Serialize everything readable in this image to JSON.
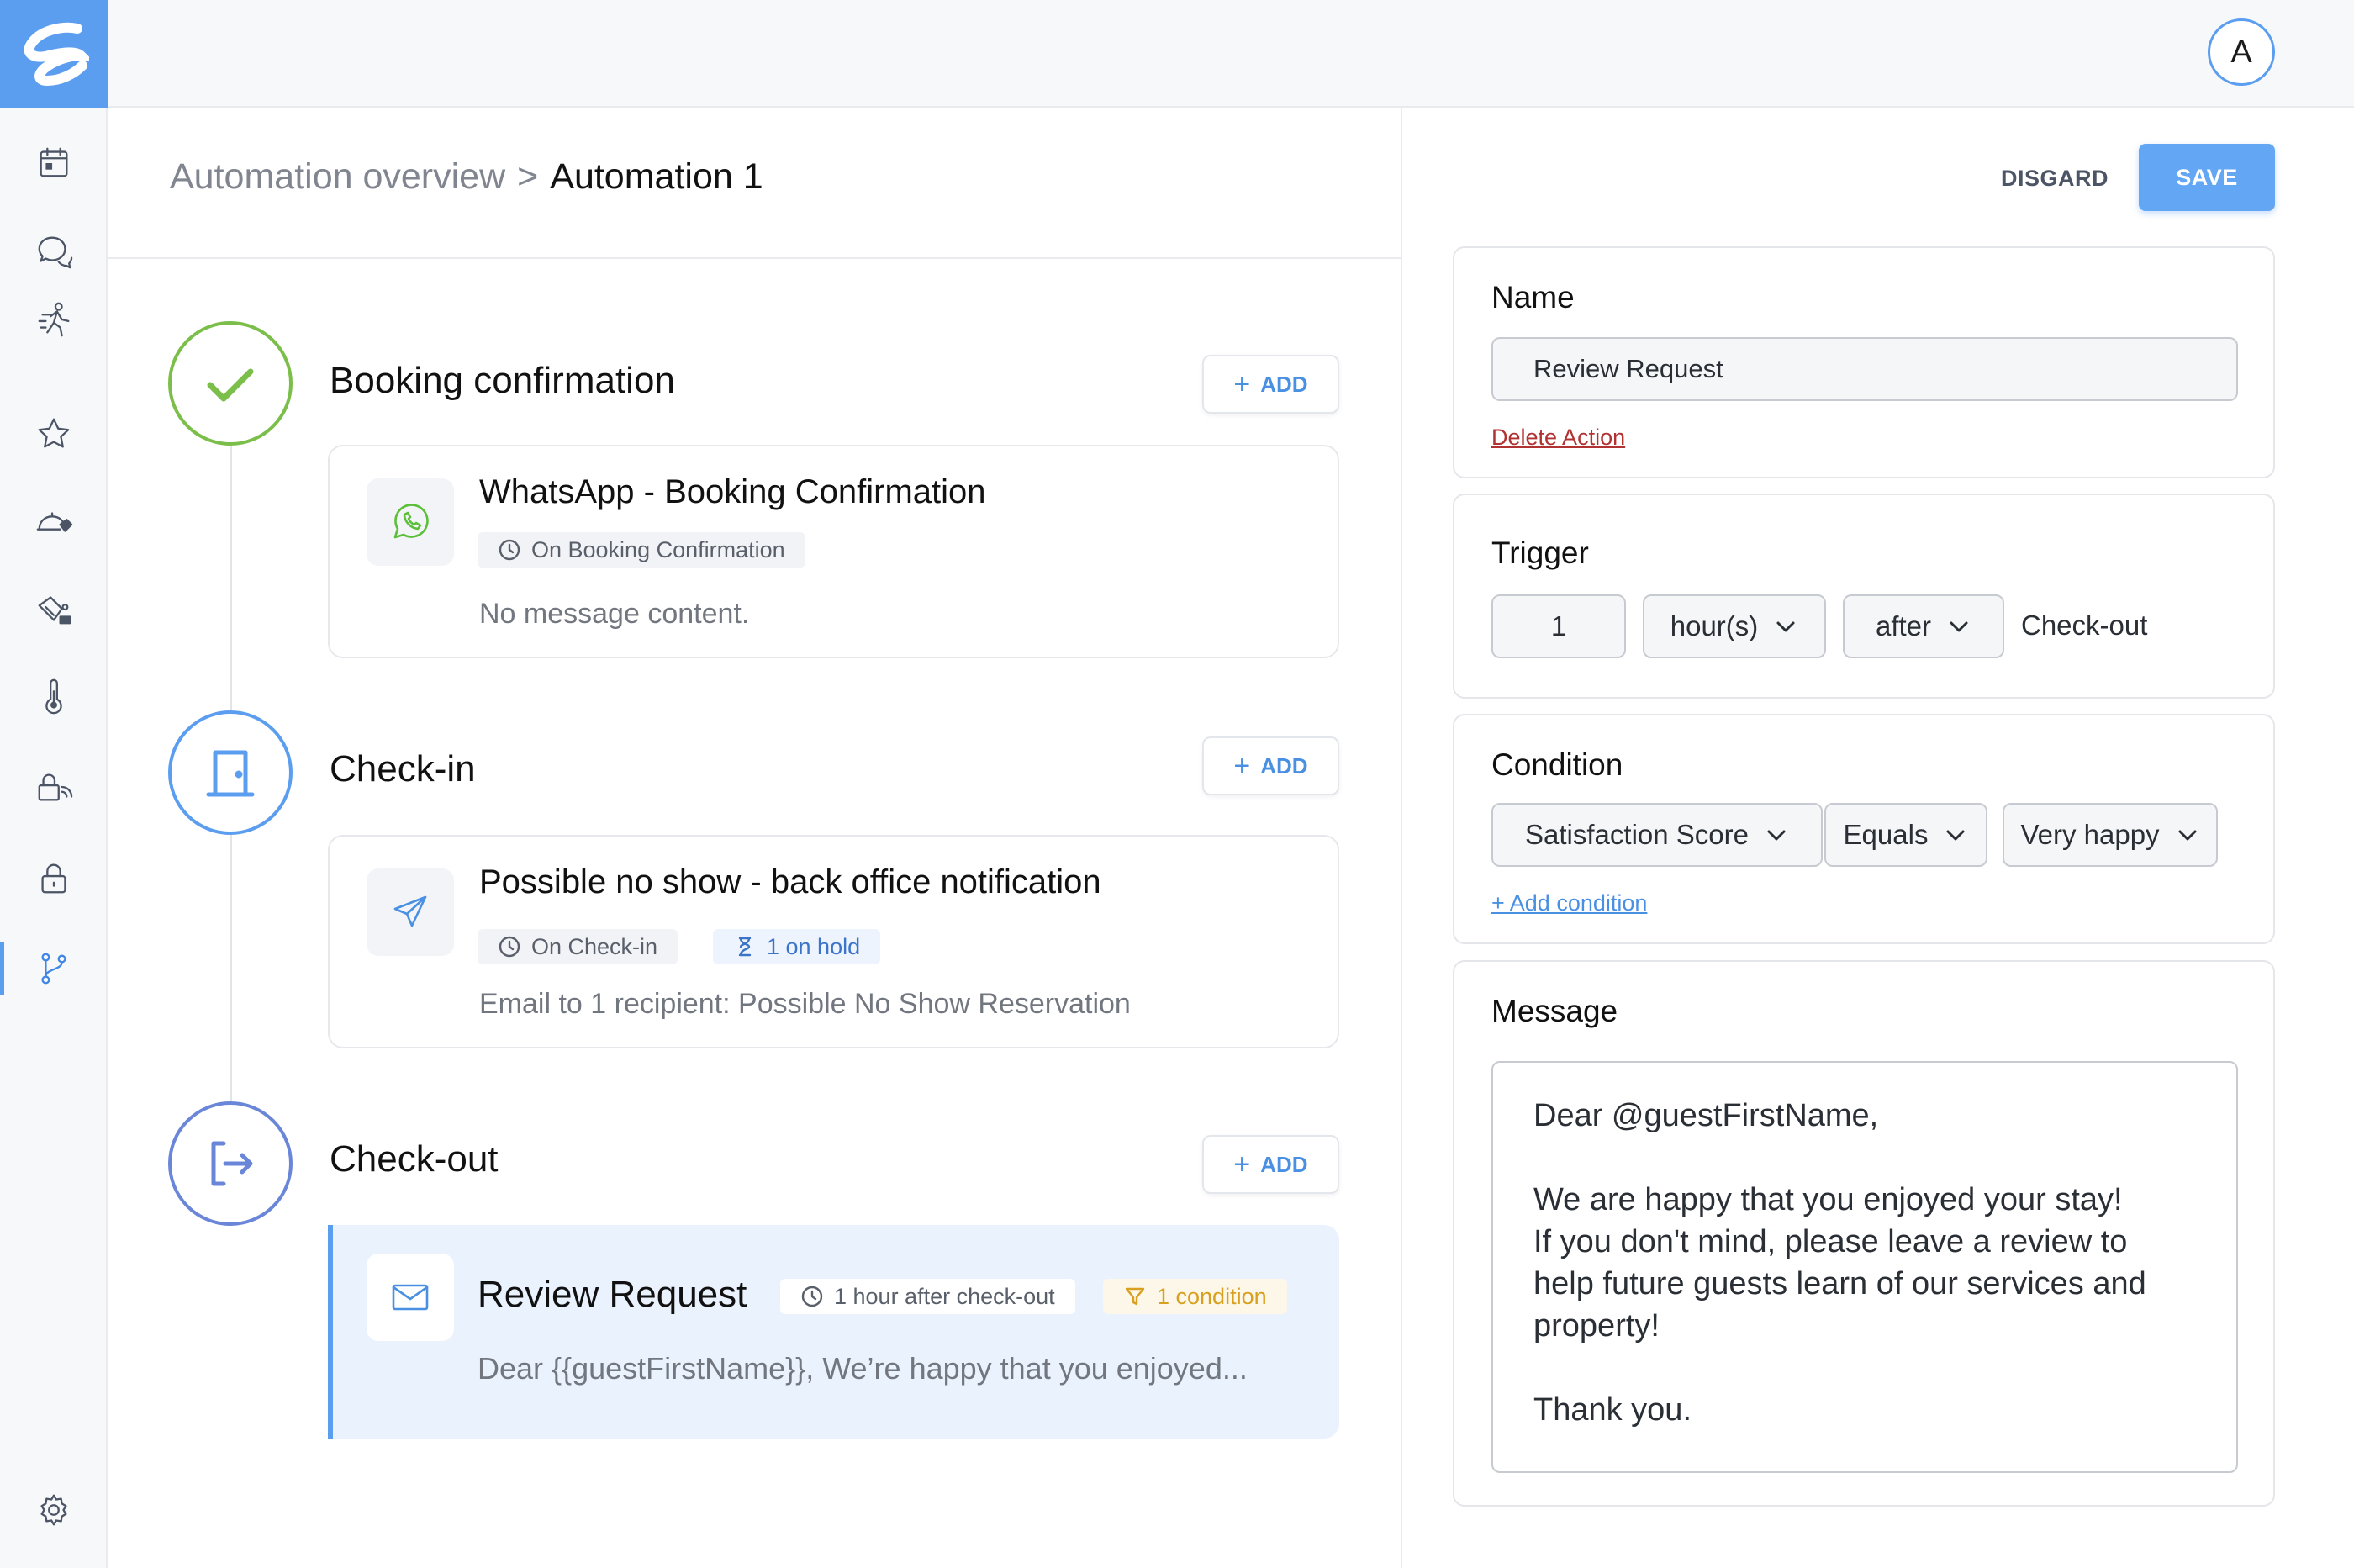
{
  "user": {
    "avatar_initial": "A"
  },
  "sidebar": {
    "items": [
      {
        "icon": "calendar-icon"
      },
      {
        "icon": "chat-icon"
      },
      {
        "icon": "activity-icon"
      },
      {
        "icon": "star-icon"
      },
      {
        "icon": "service-tag-icon"
      },
      {
        "icon": "cleaning-icon"
      },
      {
        "icon": "thermometer-icon"
      },
      {
        "icon": "access-icon"
      },
      {
        "icon": "lock-icon"
      },
      {
        "icon": "workflow-icon",
        "active": true
      }
    ],
    "settings_icon": "gear-icon",
    "accent_color": "#5b9ef0"
  },
  "breadcrumb": {
    "parent": "Automation overview",
    "separator": ">",
    "current": "Automation 1"
  },
  "timeline": {
    "add_label": "ADD",
    "stages": [
      {
        "title": "Booking confirmation",
        "icon": "check-icon",
        "color": "#7bbf4a",
        "card": {
          "icon": "whatsapp-icon",
          "title": "WhatsApp - Booking Confirmation",
          "trigger": "On Booking Confirmation",
          "text": "No message content."
        }
      },
      {
        "title": "Check-in",
        "icon": "door-icon",
        "color": "#5b9ef0",
        "card": {
          "icon": "send-icon",
          "title": "Possible no show - back office notification",
          "trigger": "On Check-in",
          "hold": "1 on hold",
          "text": "Email to 1 recipient: Possible No Show Reservation"
        }
      },
      {
        "title": "Check-out",
        "icon": "exit-icon",
        "color": "#6a86d8",
        "card": {
          "icon": "mail-icon",
          "title": "Review Request",
          "trigger": "1 hour after check-out",
          "condition": "1 condition",
          "text": "Dear {{guestFirstName}}, We’re happy that you enjoyed...",
          "selected": true
        }
      }
    ]
  },
  "editor": {
    "discard_label": "DISGARD",
    "save_label": "SAVE",
    "name": {
      "label": "Name",
      "value": "Review Request",
      "delete_label": "Delete Action"
    },
    "trigger": {
      "label": "Trigger",
      "amount": "1",
      "unit": "hour(s)",
      "relation": "after",
      "event": "Check-out"
    },
    "condition": {
      "label": "Condition",
      "field": "Satisfaction Score",
      "operator": "Equals",
      "value": "Very happy",
      "add_label": "+ Add condition"
    },
    "message": {
      "label": "Message",
      "greeting": "Dear @guestFirstName,",
      "line1": "We are happy that you enjoyed your stay!",
      "line2": "If you don't mind, please leave a review to help future guests learn of our services and property!",
      "closing": "Thank you."
    }
  }
}
